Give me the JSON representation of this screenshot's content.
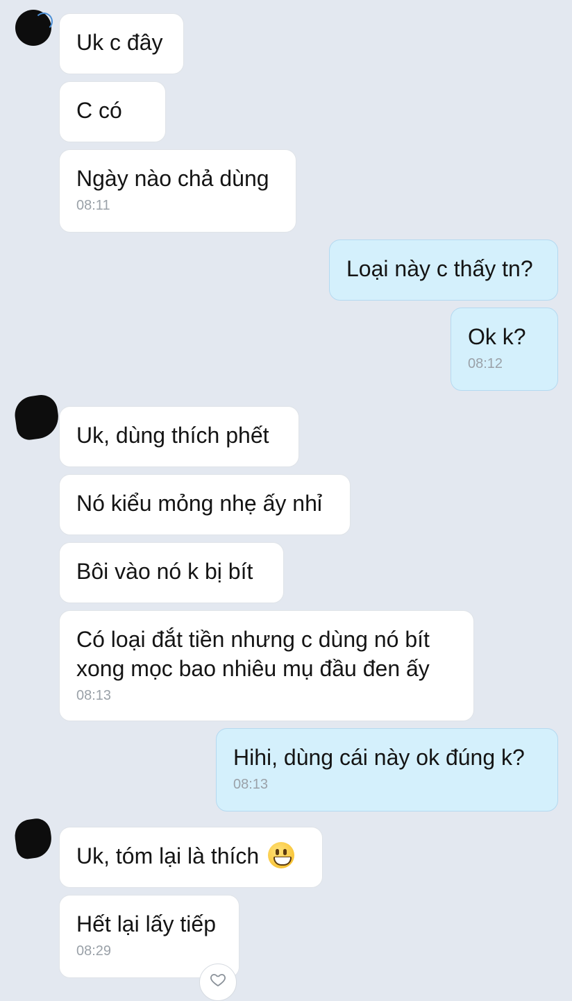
{
  "conversation": {
    "groups": [
      {
        "sender": "contact",
        "messages": [
          {
            "text": "Uk c đây"
          },
          {
            "text": "C có"
          },
          {
            "text": "Ngày nào chả dùng",
            "time": "08:11"
          }
        ]
      },
      {
        "sender": "me",
        "messages": [
          {
            "text": "Loại này c thấy tn?"
          },
          {
            "text": "Ok k?",
            "time": "08:12"
          }
        ]
      },
      {
        "sender": "contact",
        "messages": [
          {
            "text": "Uk, dùng thích phết"
          },
          {
            "text": "Nó kiểu mỏng nhẹ ấy nhỉ"
          },
          {
            "text": "Bôi vào nó k bị bít"
          },
          {
            "text": "Có loại đắt tiền nhưng c dùng nó bít\nxong mọc bao nhiêu mụ đầu đen ấy",
            "time": "08:13"
          }
        ]
      },
      {
        "sender": "me",
        "messages": [
          {
            "text": "Hihi, dùng cái này ok đúng k?",
            "time": "08:13"
          }
        ]
      },
      {
        "sender": "contact",
        "messages": [
          {
            "text": "Uk, tóm lại là thích",
            "emoji": "grinning-face"
          },
          {
            "text": "Hết lại lấy tiếp",
            "time": "08:29"
          }
        ]
      }
    ]
  },
  "colors": {
    "background": "#e3e8f0",
    "incoming_bubble": "#ffffff",
    "outgoing_bubble": "#d4f0fc",
    "outgoing_border": "#b4d9f0",
    "timestamp": "#9aa1a8"
  },
  "icons": {
    "reaction": "heart-outline-icon",
    "avatar": "contact-avatar"
  }
}
